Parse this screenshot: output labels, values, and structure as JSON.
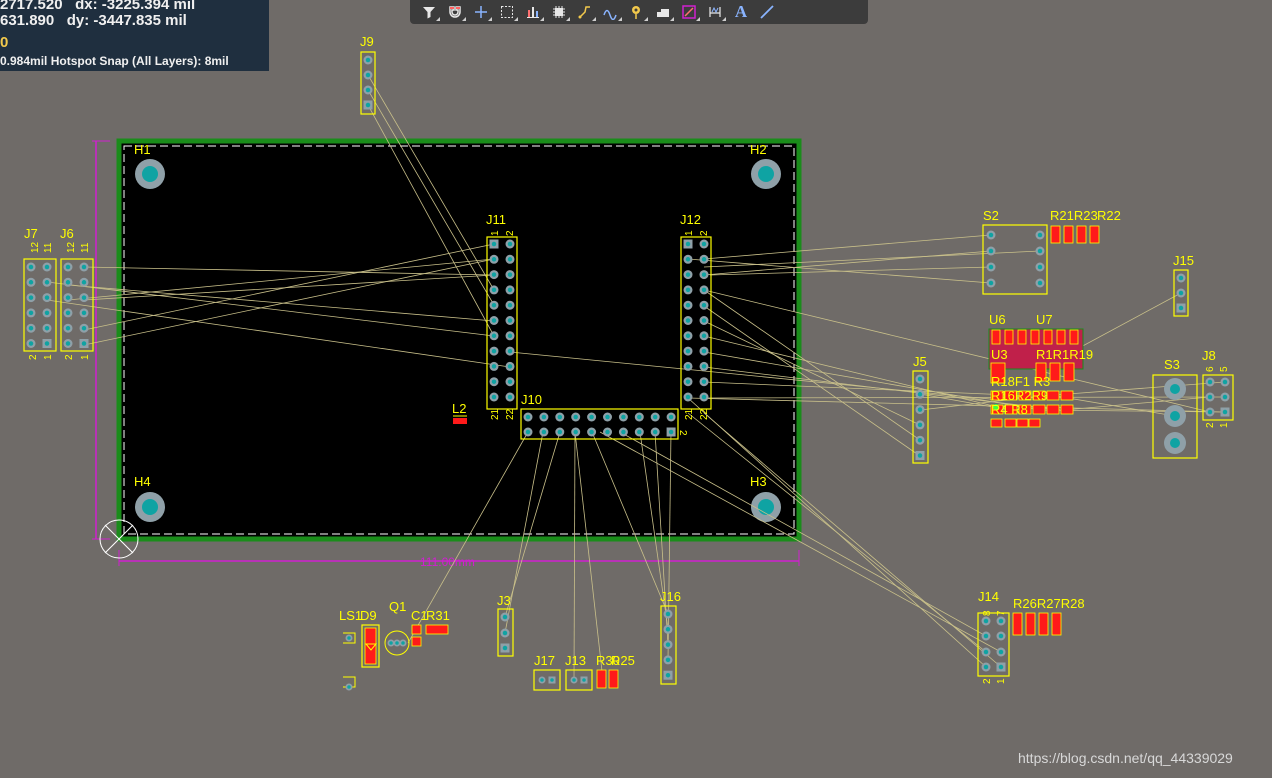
{
  "hud": {
    "x_value": "2717.520",
    "dx": "dx: -3225.394 mil",
    "y_value": "631.890",
    "dy": "dy: -3447.835 mil",
    "layer_marker": "0",
    "snap_text": "0.984mil Hotspot Snap (All Layers): 8mil"
  },
  "toolbar": [
    {
      "name": "filter-tool-button",
      "icon": "funnel-icon"
    },
    {
      "name": "snap-tool-button",
      "icon": "magnet-icon"
    },
    {
      "name": "origin-tool-button",
      "icon": "crosshair-icon"
    },
    {
      "name": "select-area-button",
      "icon": "select-rect-icon"
    },
    {
      "name": "align-tool-button",
      "icon": "align-icon"
    },
    {
      "name": "component-tool-button",
      "icon": "chip-icon"
    },
    {
      "name": "route-tool-button",
      "icon": "route-icon"
    },
    {
      "name": "diff-pair-button",
      "icon": "diffpair-icon"
    },
    {
      "name": "via-tool-button",
      "icon": "via-icon"
    },
    {
      "name": "polygon-tool-button",
      "icon": "polygon-icon"
    },
    {
      "name": "region-tool-button",
      "icon": "region-icon"
    },
    {
      "name": "dimension-tool-button",
      "icon": "dimension-icon"
    },
    {
      "name": "text-tool-button",
      "icon": "text-icon"
    },
    {
      "name": "line-tool-button",
      "icon": "line-icon"
    }
  ],
  "toolbar_text_glyph": "A",
  "board": {
    "width_dimension": "111.00mm",
    "holes": [
      "H1",
      "H2",
      "H3",
      "H4"
    ],
    "colors": {
      "board": "#000000",
      "outline": "#1a8c1a",
      "silk": "#ffff00",
      "pad": "#8fa0a8",
      "hole": "#0fa3a3",
      "ratsnest": "#c9c08a",
      "dimension": "#d020d0",
      "copper": "#ff1a1a"
    }
  },
  "designators": {
    "H1": "H1",
    "H2": "H2",
    "H3": "H3",
    "H4": "H4",
    "J9": "J9",
    "J11": "J11",
    "J12": "J12",
    "J7": "J7",
    "J6": "J6",
    "J10": "J10",
    "L2": "L2",
    "J5": "J5",
    "S2": "S2",
    "J15": "J15",
    "U6": "U6",
    "U7": "U7",
    "U3": "U3",
    "S3": "S3",
    "J8": "J8",
    "J14": "J14",
    "J3": "J3",
    "J16": "J16",
    "J17": "J17",
    "J13": "J13",
    "LS1": "LS1",
    "D9": "D9",
    "Q1": "Q1",
    "C1": "C1",
    "R31": "R31",
    "R_S2": "R21R23",
    "R_S2b": "R22",
    "R_U3": "R1R1R19",
    "R_row1": "R18F1 R3",
    "R_row2": "R16R2R9",
    "R_row3": "R4 R8",
    "R_J14": "R26R27R28",
    "R30": "R30",
    "R25": "R25"
  },
  "pin_numbers": {
    "one": "1",
    "two": "2",
    "five": "5",
    "six": "6",
    "seven": "7",
    "eight": "8",
    "eleven": "11",
    "twelve": "12",
    "twentyone": "21",
    "twentytwo": "22"
  },
  "watermark": "https://blog.csdn.net/qq_44339029"
}
